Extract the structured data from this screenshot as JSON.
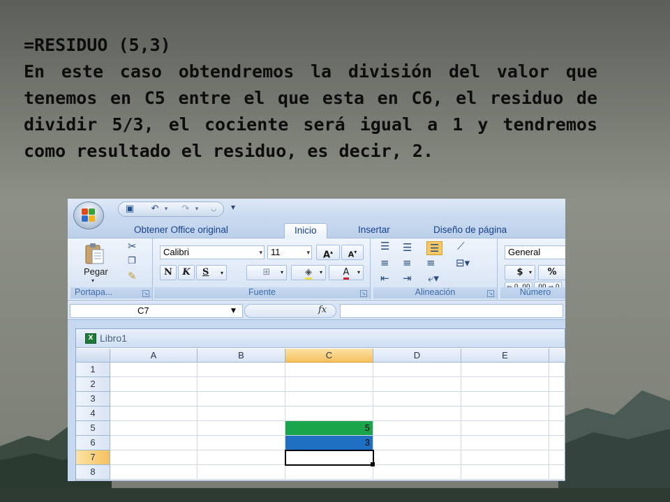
{
  "slide": {
    "title": "=RESIDUO (5,3)",
    "body": "En este caso obtendremos la división del valor que tenemos en C5 entre el que esta en C6, el residuo de dividir 5/3, el cociente será igual a 1 y tendremos como resultado el residuo, es decir, 2."
  },
  "excel": {
    "tabs": [
      "Obtener Office original",
      "Inicio",
      "Insertar",
      "Diseño de página"
    ],
    "active_tab": "Inicio",
    "clipboard": {
      "paste_label": "Pegar",
      "group_label": "Portapa..."
    },
    "font": {
      "font_name": "Calibri",
      "font_size": "11",
      "grow_label": "A",
      "shrink_label": "A",
      "bold_label": "N",
      "italic_label": "K",
      "underline_label": "S",
      "font_color_label": "A",
      "group_label": "Fuente"
    },
    "alignment": {
      "group_label": "Alineación"
    },
    "number": {
      "format": "General",
      "currency_label": "$",
      "percent_label": "%",
      "inc_decimal_label": "←.0 .00",
      "dec_decimal_label": ".00 →.0",
      "group_label": "Número"
    },
    "formula_bar": {
      "name_box": "C7",
      "fx_label": "fx",
      "formula": ""
    },
    "workbook": {
      "title": "Libro1",
      "columns": [
        "A",
        "B",
        "C",
        "D",
        "E"
      ],
      "selected_column": "C",
      "rows": [
        "1",
        "2",
        "3",
        "4",
        "5",
        "6",
        "7",
        "8"
      ],
      "selected_row": "7",
      "cells": {
        "C5": "5",
        "C6": "3",
        "C7": ""
      },
      "active_cell": "C7"
    },
    "colors": {
      "c5_fill": "#1aa54a",
      "c6_fill": "#1f6fc3",
      "selection_header": "#f6c15e"
    },
    "icons": [
      "office-button-icon",
      "save-icon",
      "undo-icon",
      "redo-icon",
      "customize-qat-icon",
      "paste-icon",
      "cut-icon",
      "copy-icon",
      "format-painter-icon",
      "borders-icon",
      "fill-color-icon",
      "excel-workbook-icon"
    ]
  }
}
